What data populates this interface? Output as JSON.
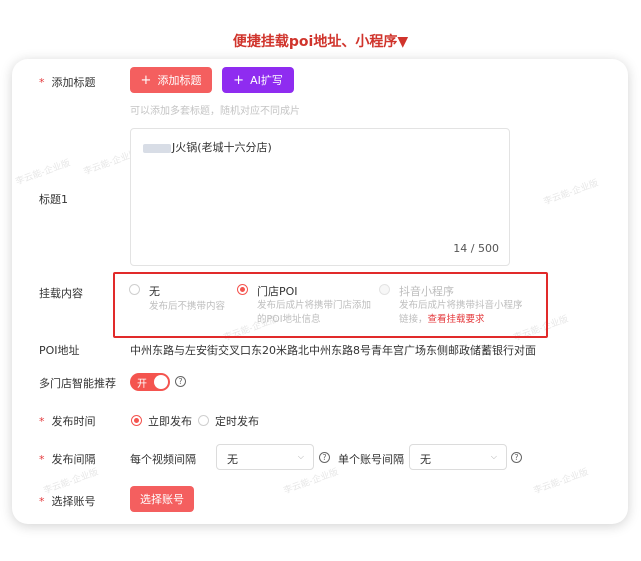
{
  "caption": "便捷挂载poi地址、小程序▼",
  "watermark": "李云能-企业版",
  "form": {
    "add_title": {
      "label": "添加标题",
      "add_button": "添加标题",
      "ai_button": "AI扩写",
      "hint": "可以添加多套标题，随机对应不同成片"
    },
    "title1": {
      "label": "标题1",
      "value_visible": "J火锅(老城十六分店)",
      "count": "14 / 500"
    },
    "mount": {
      "label": "挂载内容",
      "options": [
        {
          "title": "无",
          "desc": "发布后不携带内容",
          "selected": false,
          "disabled": false
        },
        {
          "title": "门店POI",
          "desc1": "发布后成片将携带门店添加",
          "desc2": "的POI地址信息",
          "selected": true,
          "disabled": false
        },
        {
          "title": "抖音小程序",
          "desc1": "发布后成片将携带抖音小程序",
          "desc2": "链接，",
          "link": "查看挂载要求",
          "selected": false,
          "disabled": true
        }
      ]
    },
    "poi": {
      "label": "POI地址",
      "value": "中州东路与左安街交叉口东20米路北中州东路8号青年宫广场东侧邮政储蓄银行对面"
    },
    "smart_recommend": {
      "label": "多门店智能推荐",
      "toggle": "开",
      "help": "?"
    },
    "publish_time": {
      "label": "发布时间",
      "opt_now": "立即发布",
      "opt_scheduled": "定时发布"
    },
    "publish_interval": {
      "label": "发布间隔",
      "video_label": "每个视频间隔",
      "video_value": "无",
      "account_label": "单个账号间隔",
      "account_value": "无",
      "help": "?"
    },
    "select_account": {
      "label": "选择账号",
      "button": "选择账号"
    }
  },
  "colors": {
    "accent_red": "#f45f5f",
    "ai_purple": "#8f2cf0",
    "highlight_border": "#e12a2a",
    "caption_red": "#d0342c"
  }
}
